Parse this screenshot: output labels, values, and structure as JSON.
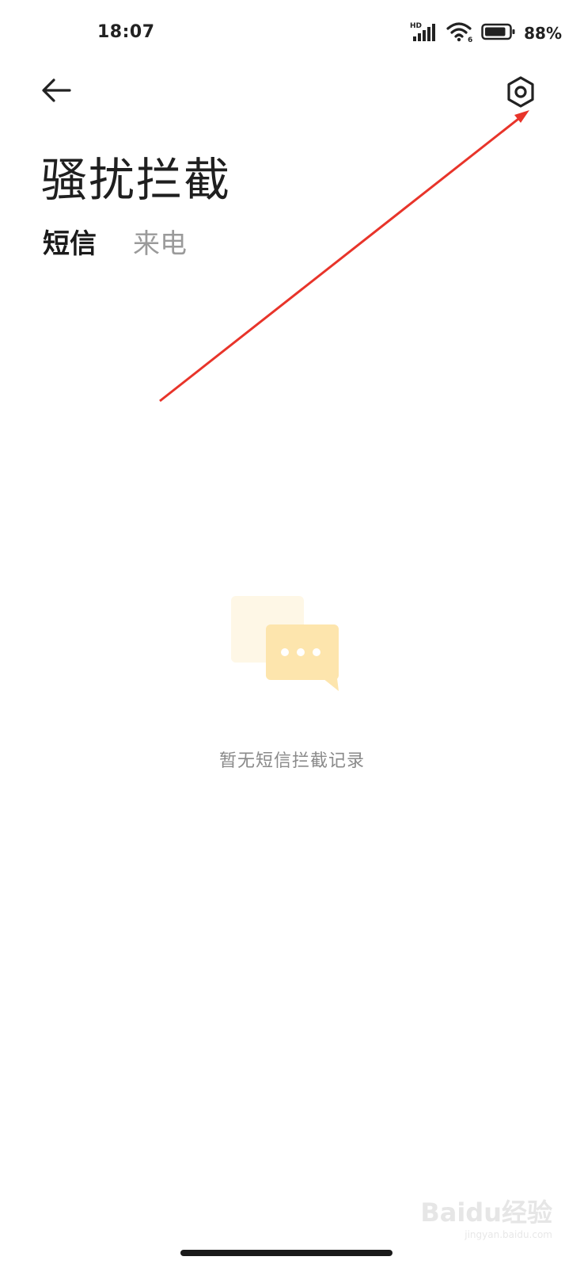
{
  "status_bar": {
    "time": "18:07",
    "network_label": "HD",
    "wifi_label": "6",
    "battery_percent": "88%",
    "battery_level": 0.88
  },
  "header": {
    "back_icon": "arrow-left-icon",
    "settings_icon": "gear-icon",
    "title": "骚扰拦截"
  },
  "tabs": [
    {
      "label": "短信",
      "active": true
    },
    {
      "label": "来电",
      "active": false
    }
  ],
  "empty_state": {
    "icon": "message-bubbles-icon",
    "message": "暂无短信拦截记录"
  },
  "watermark": {
    "text": "Baidu经验",
    "subtext": "jingyan.baidu.com"
  },
  "colors": {
    "annotation_arrow": "#e8342a",
    "empty_icon": "#fde9b8",
    "tab_inactive": "#9a9a9a"
  }
}
